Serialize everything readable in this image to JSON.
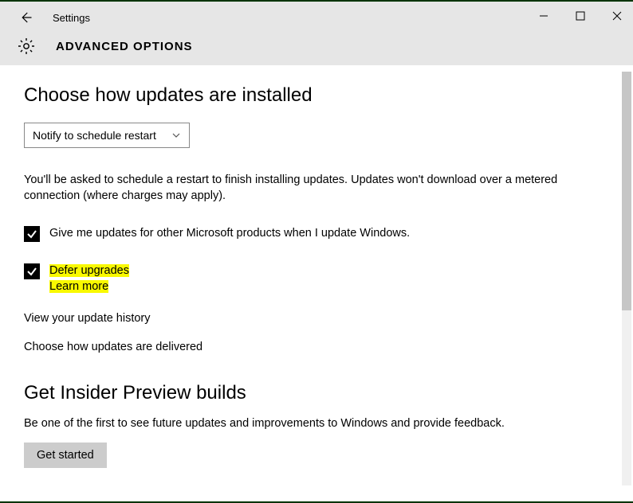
{
  "window": {
    "app_title": "Settings",
    "page_title": "ADVANCED OPTIONS"
  },
  "section1": {
    "heading": "Choose how updates are installed",
    "dropdown_selected": "Notify to schedule restart",
    "description": "You'll be asked to schedule a restart to finish installing updates. Updates won't download over a metered connection (where charges may apply).",
    "checkbox1_label": "Give me updates for other Microsoft products when I update Windows.",
    "checkbox2_label": "Defer upgrades",
    "checkbox2_link": "Learn more",
    "link_history": "View your update history",
    "link_delivered": "Choose how updates are delivered"
  },
  "section2": {
    "heading": "Get Insider Preview builds",
    "description": "Be one of the first to see future updates and improvements to Windows and provide feedback.",
    "button_label": "Get started"
  }
}
